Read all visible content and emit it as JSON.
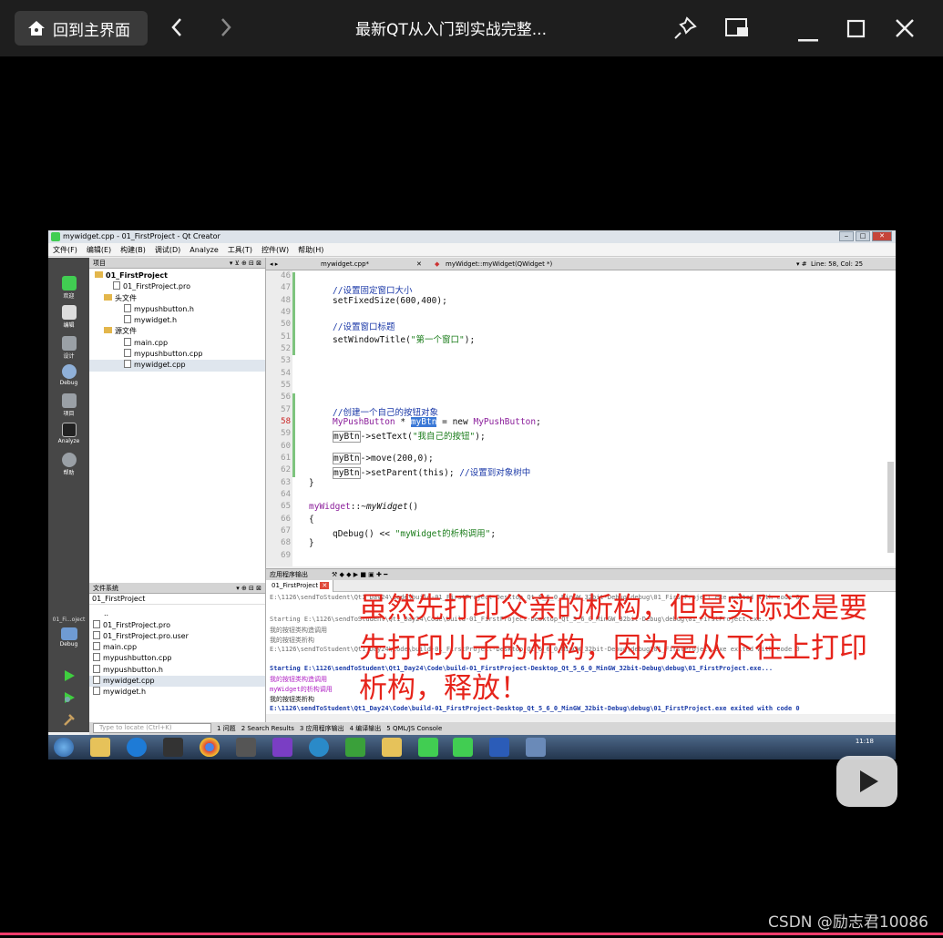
{
  "top_bar": {
    "home_label": "回到主界面",
    "title": "最新QT从入门到实战完整..."
  },
  "ide": {
    "window_title": "mywidget.cpp - 01_FirstProject - Qt Creator",
    "menu": [
      "文件(F)",
      "编辑(E)",
      "构建(B)",
      "调试(D)",
      "Analyze",
      "工具(T)",
      "控件(W)",
      "帮助(H)"
    ],
    "left_modes": [
      "欢迎",
      "编辑",
      "设计",
      "Debug",
      "项目",
      "Analyze",
      "帮助"
    ],
    "kit_label": "01_Fi...oject",
    "kit_mode": "Debug",
    "project_panel_title": "项目",
    "project_tree": [
      {
        "label": "01_FirstProject",
        "level": 0,
        "kind": "folder"
      },
      {
        "label": "01_FirstProject.pro",
        "level": 1,
        "kind": "file"
      },
      {
        "label": "头文件",
        "level": 1,
        "kind": "folder"
      },
      {
        "label": "mypushbutton.h",
        "level": 2,
        "kind": "file"
      },
      {
        "label": "mywidget.h",
        "level": 2,
        "kind": "file"
      },
      {
        "label": "源文件",
        "level": 1,
        "kind": "folder"
      },
      {
        "label": "main.cpp",
        "level": 2,
        "kind": "file"
      },
      {
        "label": "mypushbutton.cpp",
        "level": 2,
        "kind": "file"
      },
      {
        "label": "mywidget.cpp",
        "level": 2,
        "kind": "file"
      }
    ],
    "fs_panel_title": "文件系统",
    "fs_root": "01_FirstProject",
    "fs_files": [
      "..",
      "01_FirstProject.pro",
      "01_FirstProject.pro.user",
      "main.cpp",
      "mypushbutton.cpp",
      "mypushbutton.h",
      "mywidget.cpp",
      "mywidget.h"
    ],
    "editor_file": "mywidget.cpp*",
    "editor_symbol": "myWidget::myWidget(QWidget *)",
    "cursor_pos": "Line: 58, Col: 25",
    "line_numbers": [
      "46",
      "47",
      "48",
      "49",
      "50",
      "51",
      "52",
      "53",
      "54",
      "55",
      "56",
      "57",
      "58",
      "59",
      "60",
      "61",
      "62",
      "63",
      "64",
      "65",
      "66",
      "67",
      "68",
      "69"
    ],
    "code": {
      "c47": "//设置固定窗口大小",
      "c48": "setFixedSize(600,400);",
      "c50": "//设置窗口标题",
      "c51a": "setWindowTitle(",
      "c51b": "\"第一个窗口\"",
      "c51c": ");",
      "c57": "//创建一个自己的按钮对象",
      "c58a": "MyPushButton",
      "c58b": " * ",
      "c58c": "myBtn",
      "c58d": " = new ",
      "c58e": "MyPushButton",
      "c58f": ";",
      "c59a": "myBtn",
      "c59b": "->setText(",
      "c59c": "\"我自己的按钮\"",
      "c59d": ");",
      "c61a": "myBtn",
      "c61b": "->move(200,0);",
      "c62a": "myBtn",
      "c62b": "->setParent(this);",
      "c62c": " //设置到对象树中",
      "c63": "}",
      "c65a": "myWidget",
      "c65b": "::~",
      "c65c": "myWidget",
      "c65d": "()",
      "c66": "{",
      "c67a": "qDebug() << ",
      "c67b": "\"myWidget的析构调用\"",
      "c67c": ";",
      "c68": "}"
    },
    "output_panel_title": "应用程序输出",
    "output_tab": "01_FirstProject",
    "output_lines": [
      {
        "text": "E:\\1126\\sendToStudent\\Qt1_Day24\\Code\\build-01_FirstProject-Desktop_Qt_5_6_0_MinGW_32bit-Debug\\debug\\01_FirstProject.exe exited with code 0",
        "style": "gray"
      },
      {
        "text": "",
        "style": "gray"
      },
      {
        "text": "Starting E:\\1126\\sendToStudent\\Qt1_Day24\\Code\\build-01_FirstProject-Desktop_Qt_5_6_0_MinGW_32bit-Debug\\debug\\01_FirstProject.exe...",
        "style": "gray"
      },
      {
        "text": "我的按钮类构造调用",
        "style": "gray"
      },
      {
        "text": "我的按钮类析构",
        "style": "gray"
      },
      {
        "text": "E:\\1126\\sendToStudent\\Qt1_Day24\\Code\\build-01_FirstProject-Desktop_Qt_5_6_0_MinGW_32bit-Debug\\debug\\01_FirstProject.exe exited with code 0",
        "style": "gray"
      },
      {
        "text": "",
        "style": "gray"
      },
      {
        "text": "Starting E:\\1126\\sendToStudent\\Qt1_Day24\\Code\\build-01_FirstProject-Desktop_Qt_5_6_0_MinGW_32bit-Debug\\debug\\01_FirstProject.exe...",
        "style": "blue"
      },
      {
        "text": "我的按钮类构造调用",
        "style": "purple"
      },
      {
        "text": "myWidget的析构调用",
        "style": "purple"
      },
      {
        "text": "我的按钮类析构",
        "style": "black"
      },
      {
        "text": "E:\\1126\\sendToStudent\\Qt1_Day24\\Code\\build-01_FirstProject-Desktop_Qt_5_6_0_MinGW_32bit-Debug\\debug\\01_FirstProject.exe exited with code 0",
        "style": "blue"
      }
    ],
    "status_bar": {
      "locate_placeholder": "Type to locate (Ctrl+K)",
      "tabs": [
        "1 问题",
        "2 Search Results",
        "3 应用程序输出",
        "4 编译输出",
        "5 QML/JS Console"
      ]
    },
    "clock": "11:18"
  },
  "subtitle": [
    "虽然先打印父亲的析构，但是实际还是要",
    "先打印儿子的析构，因为是从下往上打印",
    "析构，释放！"
  ],
  "watermark": "CSDN @励志君10086",
  "progress": 1.0,
  "colors": {
    "subtitle": "#e6241b",
    "progress": "#ff3b6b"
  }
}
